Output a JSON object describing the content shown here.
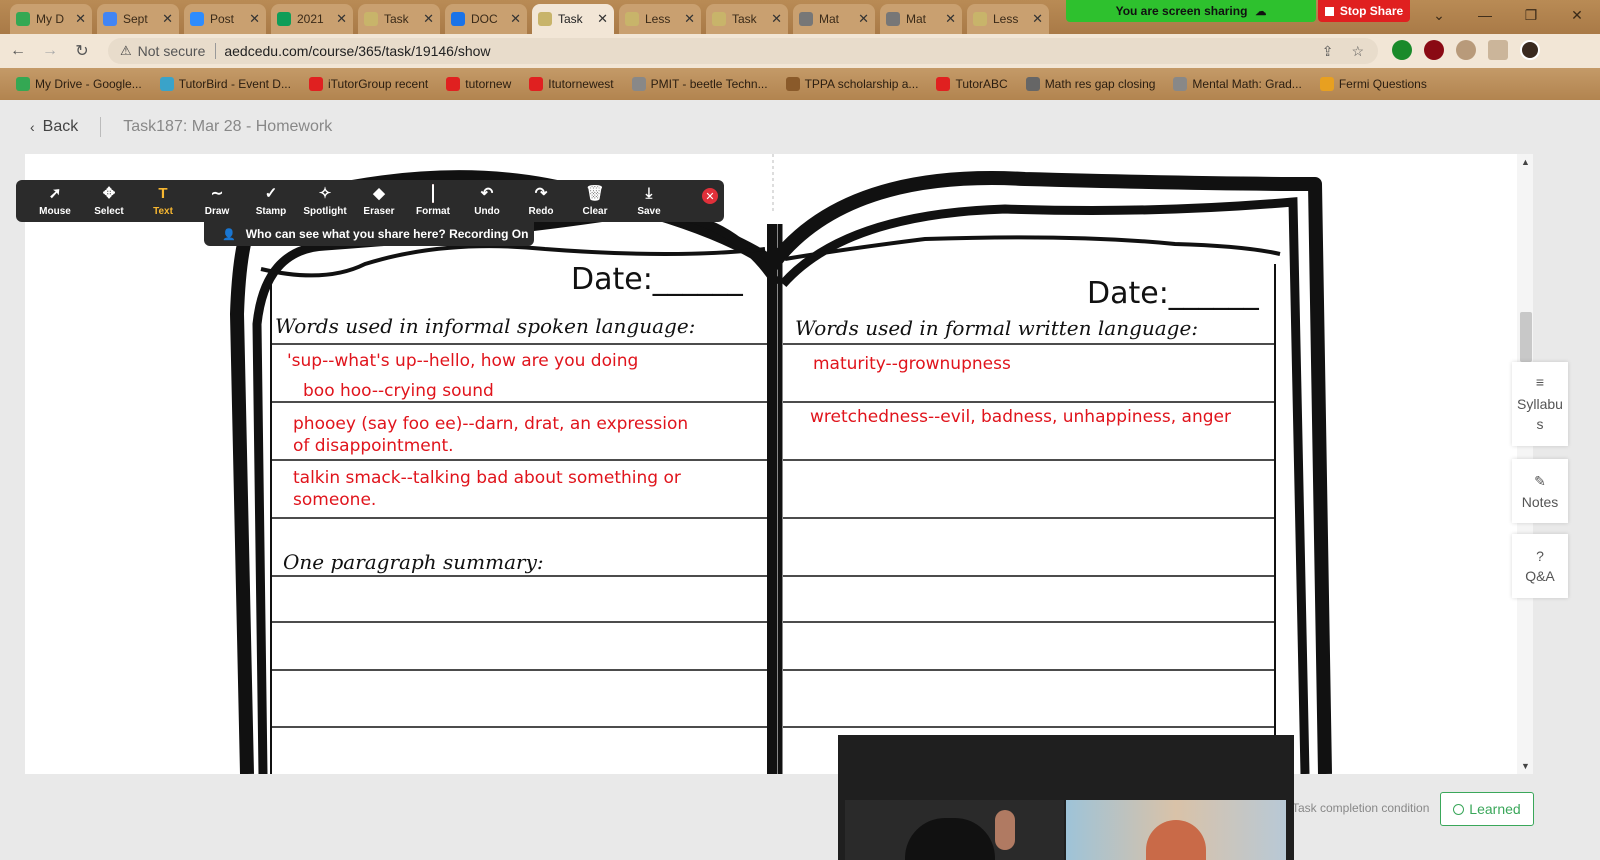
{
  "browser": {
    "tabs": [
      {
        "label": "My D",
        "color": "#34a853"
      },
      {
        "label": "Sept",
        "color": "#4285f4"
      },
      {
        "label": "Post",
        "color": "#2d8cff"
      },
      {
        "label": "2021",
        "color": "#0f9d58"
      },
      {
        "label": "Task",
        "color": "#c8b46a"
      },
      {
        "label": "DOC",
        "color": "#1a73e8"
      },
      {
        "label": "Task",
        "color": "#c8b46a",
        "active": true
      },
      {
        "label": "Less",
        "color": "#c8b46a"
      },
      {
        "label": "Task",
        "color": "#c8b46a"
      },
      {
        "label": "Mat",
        "color": "#777777"
      },
      {
        "label": "Mat",
        "color": "#777777"
      },
      {
        "label": "Less",
        "color": "#c8b46a"
      }
    ],
    "share_banner": "You are screen sharing",
    "stop_share": "Stop Share",
    "address": {
      "security": "Not secure",
      "url": "aedcedu.com/course/365/task/19146/show"
    },
    "bookmarks": [
      {
        "label": "My Drive - Google...",
        "color": "#34a853"
      },
      {
        "label": "TutorBird - Event D...",
        "color": "#3aa3c9"
      },
      {
        "label": "iTutorGroup recent",
        "color": "#e02020"
      },
      {
        "label": "tutornew",
        "color": "#e02020"
      },
      {
        "label": "Itutornewest",
        "color": "#e02020"
      },
      {
        "label": "PMIT - beetle Techn...",
        "color": "#888888"
      },
      {
        "label": "TPPA scholarship a...",
        "color": "#8a5a2a"
      },
      {
        "label": "TutorABC",
        "color": "#e02020"
      },
      {
        "label": "Math res gap closing",
        "color": "#666666"
      },
      {
        "label": "Mental Math: Grad...",
        "color": "#888888"
      },
      {
        "label": "Fermi Questions",
        "color": "#e8a020"
      }
    ]
  },
  "header": {
    "back_label": "Back",
    "task_title": "Task187:  Mar 28 - Homework"
  },
  "annotation_toolbar": {
    "tools": [
      {
        "label": "Mouse",
        "icon": "arrow-icon",
        "glyph": "➚"
      },
      {
        "label": "Select",
        "icon": "move-icon",
        "glyph": "✥"
      },
      {
        "label": "Text",
        "icon": "text-icon",
        "glyph": "T",
        "active": true
      },
      {
        "label": "Draw",
        "icon": "draw-icon",
        "glyph": "∼"
      },
      {
        "label": "Stamp",
        "icon": "stamp-icon",
        "glyph": "✓"
      },
      {
        "label": "Spotlight",
        "icon": "spotlight-icon",
        "glyph": "✧"
      },
      {
        "label": "Eraser",
        "icon": "eraser-icon",
        "glyph": "◆"
      },
      {
        "label": "Format",
        "icon": "format-icon",
        "glyph": ""
      },
      {
        "label": "Undo",
        "icon": "undo-icon",
        "glyph": "↶"
      },
      {
        "label": "Redo",
        "icon": "redo-icon",
        "glyph": "↷"
      },
      {
        "label": "Clear",
        "icon": "trash-icon",
        "glyph": "🗑"
      },
      {
        "label": "Save",
        "icon": "save-icon",
        "glyph": "⤓"
      }
    ],
    "recording_text": "Who can see what you share here? Recording On",
    "accent": "#f7b731"
  },
  "worksheet": {
    "left_date": "Date:______",
    "right_date": "Date:______",
    "left_heading": "Words used in informal spoken language:",
    "right_heading": "Words used in formal written language:",
    "summary_heading": "One paragraph summary:",
    "left_entries": [
      "'sup--what's up--hello, how are you doing",
      "boo hoo--crying sound",
      "phooey (say foo  ee)--darn, drat, an expression",
      "of disappointment.",
      "talkin smack--talking bad about something or",
      "someone."
    ],
    "right_entries": [
      "maturity--grownupness",
      "wretchedness--evil, badness, unhappiness, anger"
    ],
    "ink_color": "#e0141c"
  },
  "side_panel": {
    "syllabus": "Syllabus",
    "notes": "Notes",
    "qa": "Q&A"
  },
  "footer": {
    "completion_label": "Task completion condition",
    "learned_label": "Learned"
  }
}
